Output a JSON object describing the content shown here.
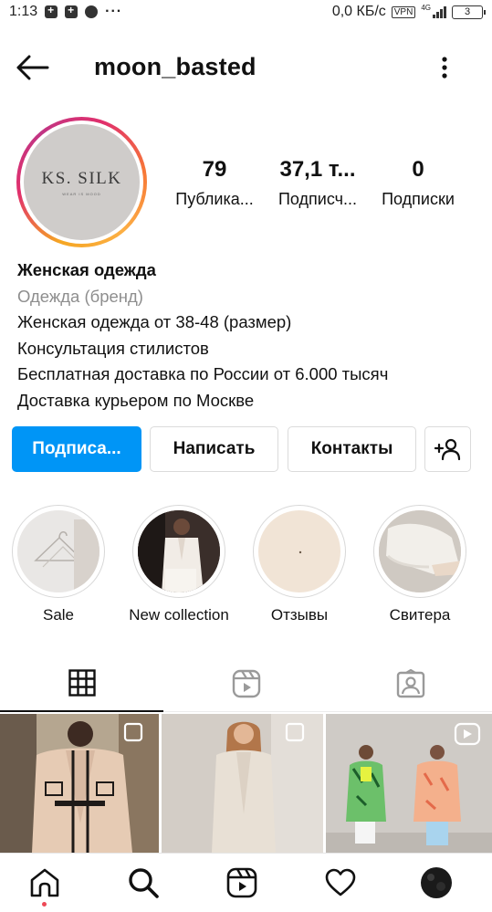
{
  "status_bar": {
    "time": "1:13",
    "network_speed": "0,0 КБ/с",
    "vpn": "VPN",
    "net_type": "4G",
    "battery": "3"
  },
  "header": {
    "username": "moon_basted"
  },
  "profile": {
    "avatar_brand": "KS. SILK",
    "avatar_sub": "WEAR IS MOOD",
    "stats": [
      {
        "value": "79",
        "label": "Публика..."
      },
      {
        "value": "37,1 т...",
        "label": "Подписч..."
      },
      {
        "value": "0",
        "label": "Подписки"
      }
    ],
    "bio": {
      "name": "Женская одежда",
      "category": "Одежда (бренд)",
      "lines": [
        "Женская одежда от 38-48 (размер)",
        "Консультация стилистов",
        "Бесплатная доставка по России от 6.000 тысяч",
        "Доставка курьером по Москве"
      ]
    }
  },
  "actions": {
    "subscribe": "Подписа...",
    "message": "Написать",
    "contacts": "Контакты"
  },
  "highlights": [
    {
      "label": "Sale"
    },
    {
      "label": "New collection"
    },
    {
      "label": "Отзывы"
    },
    {
      "label": "Свитера"
    }
  ],
  "colors": {
    "primary_button": "#0095f6",
    "notification_dot": "#ed4956"
  },
  "icons": {
    "back": "arrow-left-icon",
    "menu": "more-vertical-icon",
    "add_person": "add-person-icon",
    "grid_tab": "grid-icon",
    "reels_tab": "reels-icon",
    "tagged_tab": "tagged-icon",
    "nav_home": "home-icon",
    "nav_search": "search-icon",
    "nav_reels": "reels-icon",
    "nav_activity": "heart-icon",
    "nav_profile": "profile-avatar-icon"
  }
}
